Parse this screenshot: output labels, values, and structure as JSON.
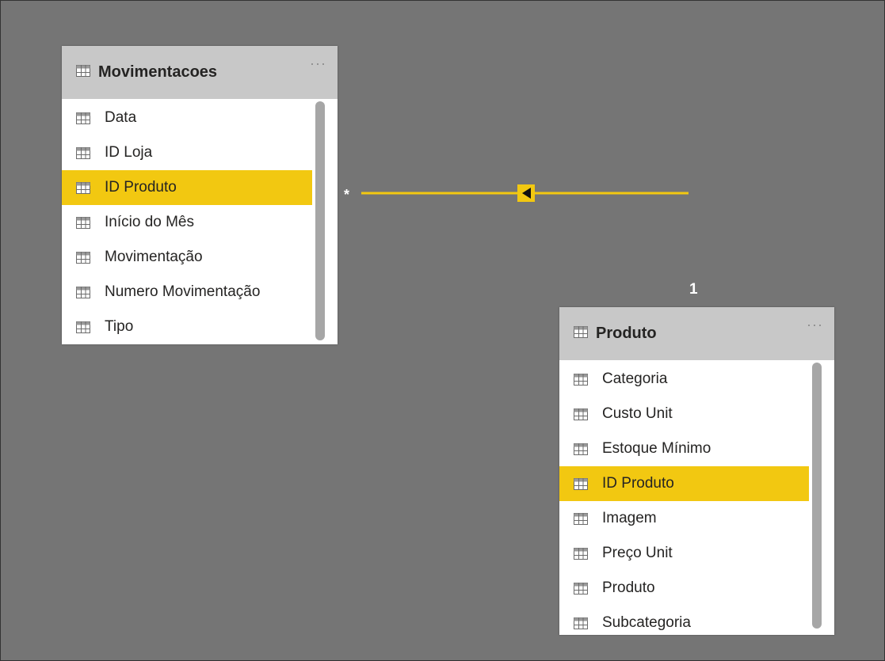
{
  "relationship": {
    "many_marker": "*",
    "one_marker": "1",
    "line_color": "#f2c811"
  },
  "tables": [
    {
      "name": "Movimentacoes",
      "more_label": "···",
      "fields": [
        "Data",
        "ID Loja",
        "ID Produto",
        "Início do Mês",
        "Movimentação",
        "Numero Movimentação",
        "Tipo"
      ],
      "highlighted_field": "ID Produto"
    },
    {
      "name": "Produto",
      "more_label": "···",
      "fields": [
        "Categoria",
        "Custo Unit",
        "Estoque Mínimo",
        "ID Produto",
        "Imagem",
        "Preço Unit",
        "Produto",
        "Subcategoria"
      ],
      "highlighted_field": "ID Produto"
    }
  ],
  "colors": {
    "canvas": "#757575",
    "card_header": "#c8c8c8",
    "highlight": "#f2c811",
    "scrollbar": "#a6a6a6"
  }
}
